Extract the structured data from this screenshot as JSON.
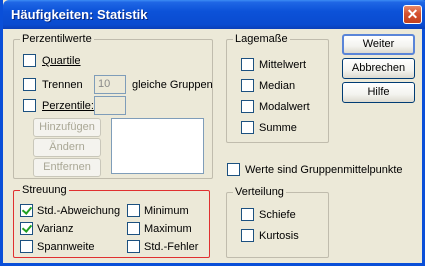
{
  "window": {
    "title": "Häufigkeiten: Statistik"
  },
  "perzentilwerte": {
    "title": "Perzentilwerte",
    "quartile": {
      "label": "Quartile",
      "checked": false
    },
    "trennen": {
      "label": "Trennen",
      "checked": false,
      "value": "10",
      "suffix": "gleiche Gruppen"
    },
    "perzentile": {
      "label": "Perzentile:",
      "checked": false,
      "value": ""
    },
    "buttons": {
      "add": "Hinzufügen",
      "change": "Ändern",
      "remove": "Entfernen"
    }
  },
  "lagemasse": {
    "title": "Lagemaße",
    "items": [
      {
        "label": "Mittelwert",
        "checked": false
      },
      {
        "label": "Median",
        "checked": false
      },
      {
        "label": "Modalwert",
        "checked": false
      },
      {
        "label": "Summe",
        "checked": false
      }
    ]
  },
  "gruppenmittelpunkte": {
    "label": "Werte sind Gruppenmittelpunkte",
    "checked": false
  },
  "streuung": {
    "title": "Streuung",
    "items": [
      {
        "label": "Std.-Abweichung",
        "checked": true
      },
      {
        "label": "Varianz",
        "checked": true
      },
      {
        "label": "Spannweite",
        "checked": false
      },
      {
        "label": "Minimum",
        "checked": false
      },
      {
        "label": "Maximum",
        "checked": false
      },
      {
        "label": "Std.-Fehler",
        "checked": false
      }
    ]
  },
  "verteilung": {
    "title": "Verteilung",
    "items": [
      {
        "label": "Schiefe",
        "checked": false
      },
      {
        "label": "Kurtosis",
        "checked": false
      }
    ]
  },
  "actions": {
    "continue": "Weiter",
    "cancel": "Abbrechen",
    "help": "Hilfe"
  },
  "colors": {
    "title_bar": "#0a4bd0",
    "highlight_border": "#e03030",
    "checkmark": "#21a121"
  }
}
